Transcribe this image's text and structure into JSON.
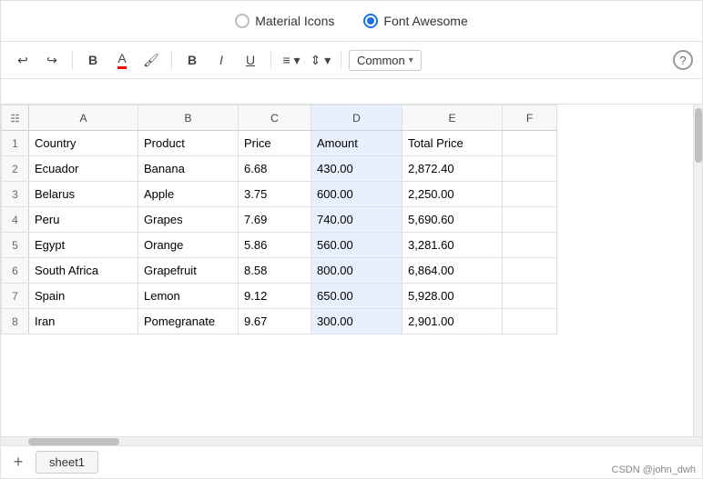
{
  "radioBar": {
    "option1": {
      "label": "Material Icons",
      "checked": false
    },
    "option2": {
      "label": "Font Awesome",
      "checked": true
    }
  },
  "toolbar": {
    "undoLabel": "↩",
    "redoLabel": "↪",
    "boldLabel": "B",
    "italicLabel": "I",
    "underlineLabel": "U",
    "fontColorLabel": "A",
    "bgColorLabel": "🎨",
    "alignLabel": "≡",
    "vertAlignLabel": "⬍",
    "fontStyleDropdown": "Common",
    "helpLabel": "?"
  },
  "spreadsheet": {
    "columns": [
      "",
      "A",
      "B",
      "C",
      "D",
      "E",
      "F"
    ],
    "rows": [
      {
        "num": "",
        "cells": [
          "",
          "Country",
          "Product",
          "Price",
          "Amount",
          "Total Price",
          ""
        ]
      },
      {
        "num": "1",
        "cells": [
          "1",
          "Country",
          "Product",
          "Price",
          "Amount",
          "Total Price",
          ""
        ]
      },
      {
        "num": "2",
        "cells": [
          "2",
          "Ecuador",
          "Banana",
          "6.68",
          "430.00",
          "2,872.40",
          ""
        ]
      },
      {
        "num": "3",
        "cells": [
          "3",
          "Belarus",
          "Apple",
          "3.75",
          "600.00",
          "2,250.00",
          ""
        ]
      },
      {
        "num": "4",
        "cells": [
          "4",
          "Peru",
          "Grapes",
          "7.69",
          "740.00",
          "5,690.60",
          ""
        ]
      },
      {
        "num": "5",
        "cells": [
          "5",
          "Egypt",
          "Orange",
          "5.86",
          "560.00",
          "3,281.60",
          ""
        ]
      },
      {
        "num": "6",
        "cells": [
          "6",
          "South Africa",
          "Grapefruit",
          "8.58",
          "800.00",
          "6,864.00",
          ""
        ]
      },
      {
        "num": "7",
        "cells": [
          "7",
          "Spain",
          "Lemon",
          "9.12",
          "650.00",
          "5,928.00",
          ""
        ]
      },
      {
        "num": "8",
        "cells": [
          "8",
          "Iran",
          "Pomegranate",
          "9.67",
          "300.00",
          "2,901.00",
          ""
        ]
      }
    ]
  },
  "sheets": {
    "addButton": "+",
    "tabs": [
      "sheet1"
    ]
  },
  "watermark": "CSDN @john_dwh"
}
